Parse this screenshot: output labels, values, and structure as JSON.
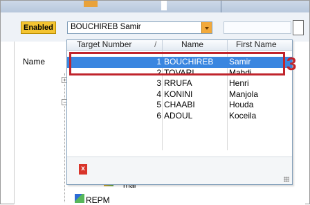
{
  "toolbar": {
    "enabled_label": "Enabled",
    "target_selected": "BOUCHIREB Samir"
  },
  "tree": {
    "name_label": "Name",
    "expand_glyph": "+",
    "collapse_glyph": "−",
    "partial_item": "rnal",
    "repm_label": "REPM"
  },
  "dropdown": {
    "columns": [
      "Target Number",
      "Name",
      "First Name"
    ],
    "sort_glyph": "/",
    "rows": [
      {
        "num": "1",
        "name": "BOUCHIREB",
        "first": "Samir"
      },
      {
        "num": "2",
        "name": "TOVARI",
        "first": "Mahdi"
      },
      {
        "num": "3",
        "name": "RRUFA",
        "first": "Henri"
      },
      {
        "num": "4",
        "name": "KONINI",
        "first": "Manjola"
      },
      {
        "num": "5",
        "name": "CHAABI",
        "first": "Houda"
      },
      {
        "num": "6",
        "name": "ADOUL",
        "first": "Koceila"
      }
    ],
    "clear_glyph": "x"
  },
  "annotation": {
    "number": "3",
    "color": "#c0242c"
  },
  "colors": {
    "selection": "#3a86e0",
    "enabled_badge": "#f4c431",
    "dropdown_button": "#f2a93b"
  }
}
